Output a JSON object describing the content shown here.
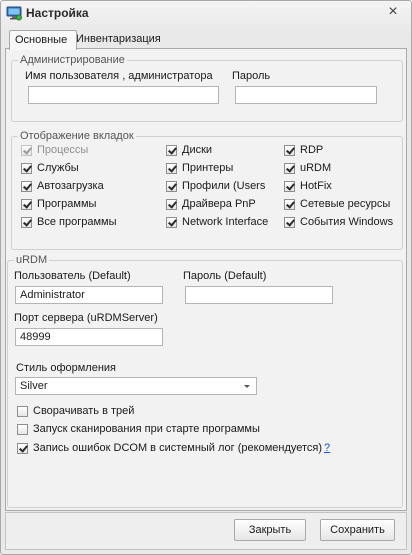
{
  "window": {
    "title": "Настройка",
    "close_glyph": "×"
  },
  "tabs": [
    {
      "label": "Основные",
      "active": true
    },
    {
      "label": "Инвентаризация",
      "active": false
    }
  ],
  "admin": {
    "legend": "Администрирование",
    "user_label": "Имя пользователя , администратора",
    "user_value": "",
    "password_label": "Пароль",
    "password_value": ""
  },
  "tabs_display": {
    "legend": "Отображение вкладок",
    "col1": [
      {
        "label": "Процессы",
        "checked": true,
        "disabled": true
      },
      {
        "label": "Службы",
        "checked": true,
        "disabled": false
      },
      {
        "label": "Автозагрузка",
        "checked": true,
        "disabled": false
      },
      {
        "label": "Программы",
        "checked": true,
        "disabled": false
      },
      {
        "label": "Все программы",
        "checked": true,
        "disabled": false
      }
    ],
    "col2": [
      {
        "label": "Диски",
        "checked": true,
        "disabled": false
      },
      {
        "label": "Принтеры",
        "checked": true,
        "disabled": false
      },
      {
        "label": "Профили (Users",
        "checked": true,
        "disabled": false
      },
      {
        "label": "Драйвера PnP",
        "checked": true,
        "disabled": false
      },
      {
        "label": "Network Interface",
        "checked": true,
        "disabled": false
      }
    ],
    "col3": [
      {
        "label": "RDP",
        "checked": true,
        "disabled": false
      },
      {
        "label": "uRDM",
        "checked": true,
        "disabled": false
      },
      {
        "label": "HotFix",
        "checked": true,
        "disabled": false
      },
      {
        "label": "Сетевые ресурсы",
        "checked": true,
        "disabled": false
      },
      {
        "label": "События Windows",
        "checked": true,
        "disabled": false
      }
    ]
  },
  "urdm": {
    "legend": "uRDM",
    "user_label": "Пользователь (Default)",
    "user_value": "Administrator",
    "password_label": "Пароль (Default)",
    "password_value": "",
    "port_label": "Порт сервера (uRDMServer)",
    "port_value": "48999",
    "style_label": "Стиль оформления",
    "style_value": "Silver",
    "options": [
      {
        "label": "Сворачивать в трей",
        "checked": false
      },
      {
        "label": "Запуск сканирования при старте программы",
        "checked": false
      },
      {
        "label": "Запись ошибок DCOM в системный лог (рекомендуется)",
        "checked": true
      }
    ],
    "help_link": "?"
  },
  "buttons": {
    "close": "Закрыть",
    "save": "Сохранить"
  },
  "icons": {
    "app": "monitor-icon",
    "close": "close-icon",
    "dropdown": "chevron-down-icon"
  }
}
